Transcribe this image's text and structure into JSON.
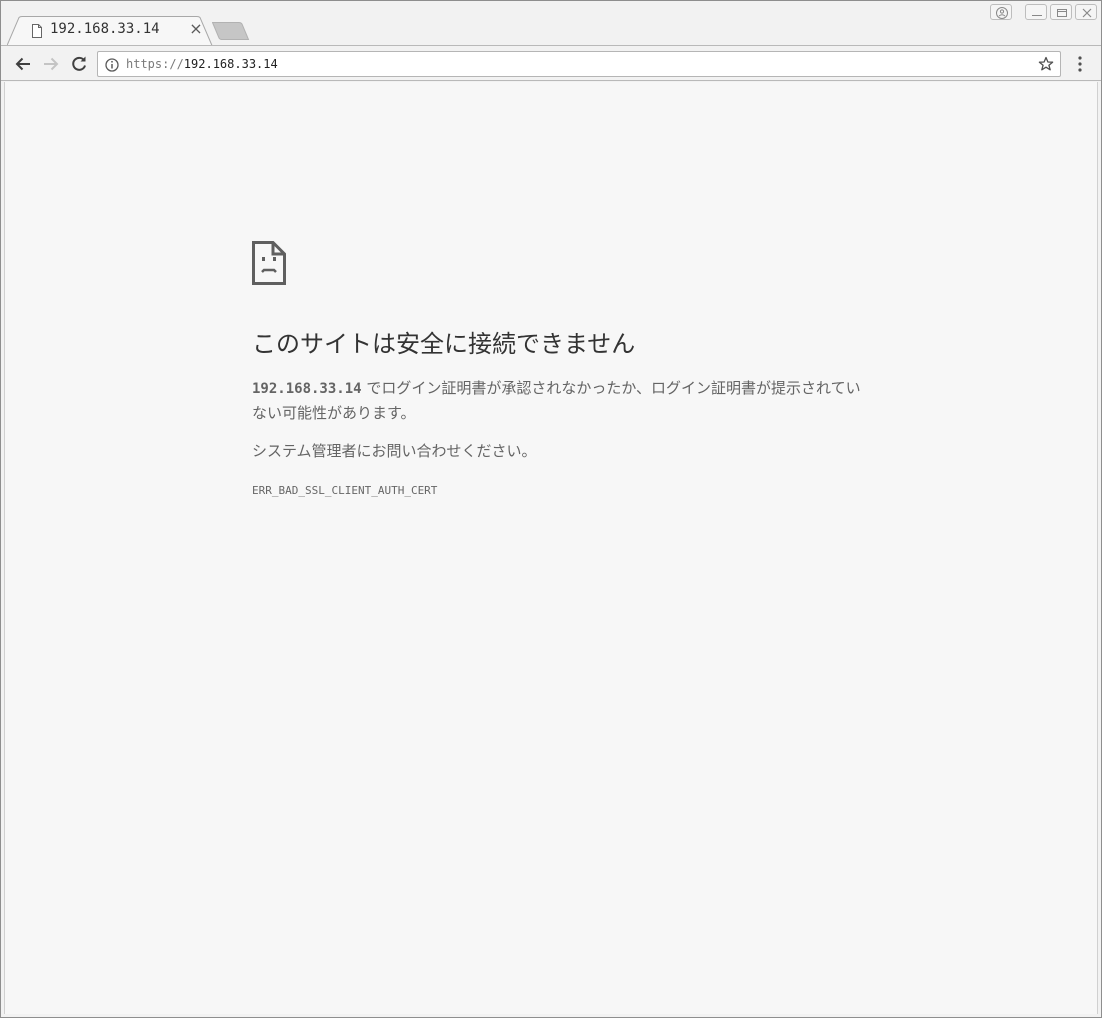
{
  "browser": {
    "tab": {
      "title": "192.168.33.14",
      "close_symbol": "×",
      "favicon": "document-icon"
    },
    "window_controls": [
      "profile-icon",
      "minimize-icon",
      "maximize-icon",
      "close-window-icon"
    ]
  },
  "toolbar": {
    "back_icon": "back-arrow-icon",
    "forward_icon": "forward-arrow-icon",
    "reload_icon": "reload-icon",
    "omnibox": {
      "scheme": "https://",
      "host": "192.168.33.14",
      "info_icon": "info-icon",
      "star_icon": "bookmark-star-icon"
    },
    "menu_icon": "vertical-dots-menu-icon"
  },
  "error_page": {
    "icon": "sad-document-icon",
    "heading": "このサイトは安全に接続できません",
    "host": "192.168.33.14",
    "description_line1": " でログイン証明書が承認されなかったか、ログイン証明書が提示されてい",
    "description_line2": "ない可能性があります。",
    "admin_note": "システム管理者にお問い合わせください。",
    "error_code": "ERR_BAD_SSL_CLIENT_AUTH_CERT"
  },
  "colors": {
    "chrome_bg": "#f2f2f2",
    "content_bg": "#f7f7f7",
    "heading_text": "#333333",
    "body_text": "#646464"
  }
}
